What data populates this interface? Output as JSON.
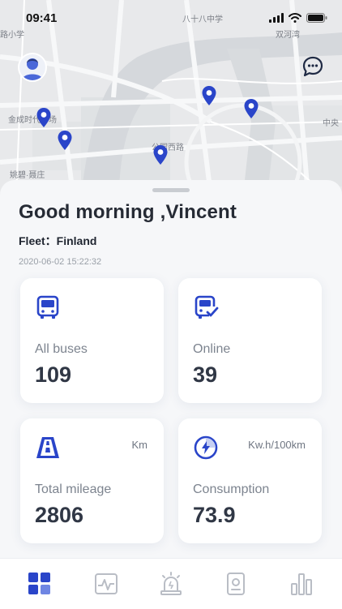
{
  "status": {
    "time": "09:41"
  },
  "map": {
    "labels": [
      "八十八中学",
      "双河湾",
      "路小学",
      "金成时代广场",
      "中央",
      "公园西路",
      "姚碧·聂庄"
    ]
  },
  "greeting": "Good morning ,Vincent",
  "fleet": "Fleet：Finland",
  "timestamp": "2020-06-02 15:22:32",
  "cards": [
    {
      "label": "All buses",
      "value": "109",
      "unit": "",
      "icon": "bus-icon"
    },
    {
      "label": "Online",
      "value": "39",
      "unit": "",
      "icon": "bus-online-icon"
    },
    {
      "label": "Total mileage",
      "value": "2806",
      "unit": "Km",
      "icon": "road-icon"
    },
    {
      "label": "Consumption",
      "value": "73.9",
      "unit": "Kw.h/100km",
      "icon": "energy-icon"
    }
  ],
  "tabs": [
    "dashboard-icon",
    "monitor-icon",
    "alarm-icon",
    "device-icon",
    "statistics-icon"
  ],
  "colors": {
    "accent": "#2a45c9",
    "background": "#f6f7f9"
  }
}
